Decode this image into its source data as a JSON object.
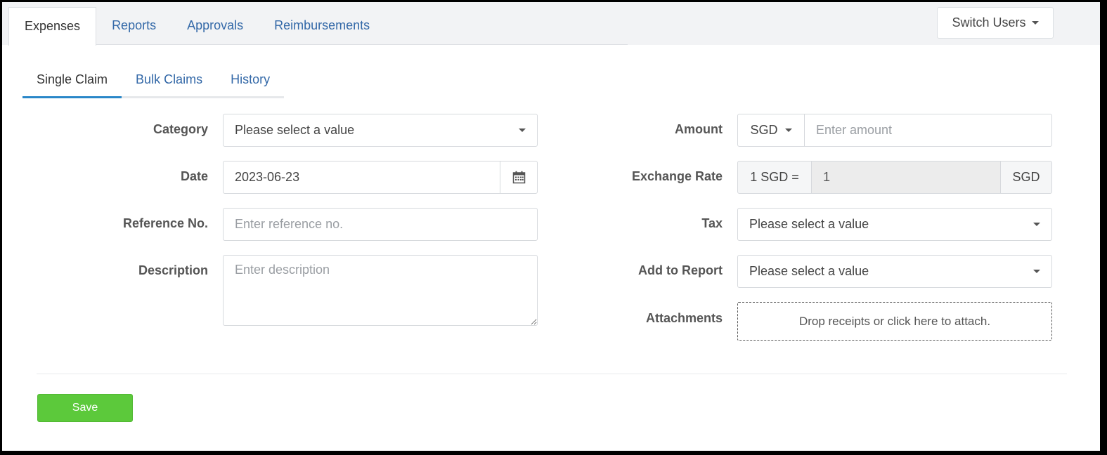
{
  "main_tabs": [
    {
      "label": "Expenses",
      "active": true
    },
    {
      "label": "Reports",
      "active": false
    },
    {
      "label": "Approvals",
      "active": false
    },
    {
      "label": "Reimbursements",
      "active": false
    }
  ],
  "switch_users": {
    "label": "Switch Users",
    "icon": "caret-down-icon"
  },
  "sub_tabs": [
    {
      "label": "Single Claim",
      "active": true
    },
    {
      "label": "Bulk Claims",
      "active": false
    },
    {
      "label": "History",
      "active": false
    }
  ],
  "form": {
    "category": {
      "label": "Category",
      "value": "Please select a value"
    },
    "date": {
      "label": "Date",
      "value": "2023-06-23",
      "icon": "calendar-icon"
    },
    "reference": {
      "label": "Reference No.",
      "placeholder": "Enter reference no."
    },
    "description": {
      "label": "Description",
      "placeholder": "Enter description"
    },
    "amount": {
      "label": "Amount",
      "currency": "SGD",
      "placeholder": "Enter amount"
    },
    "exchange_rate": {
      "label": "Exchange Rate",
      "prefix": "1 SGD =",
      "value": "1",
      "suffix": "SGD"
    },
    "tax": {
      "label": "Tax",
      "value": "Please select a value"
    },
    "add_to_report": {
      "label": "Add to Report",
      "value": "Please select a value"
    },
    "attachments": {
      "label": "Attachments",
      "dropzone_text": "Drop receipts or click here to attach."
    }
  },
  "actions": {
    "save_label": "Save"
  },
  "colors": {
    "link": "#3469a8",
    "active_underline": "#2a87c8",
    "save_button": "#5cc93b"
  }
}
